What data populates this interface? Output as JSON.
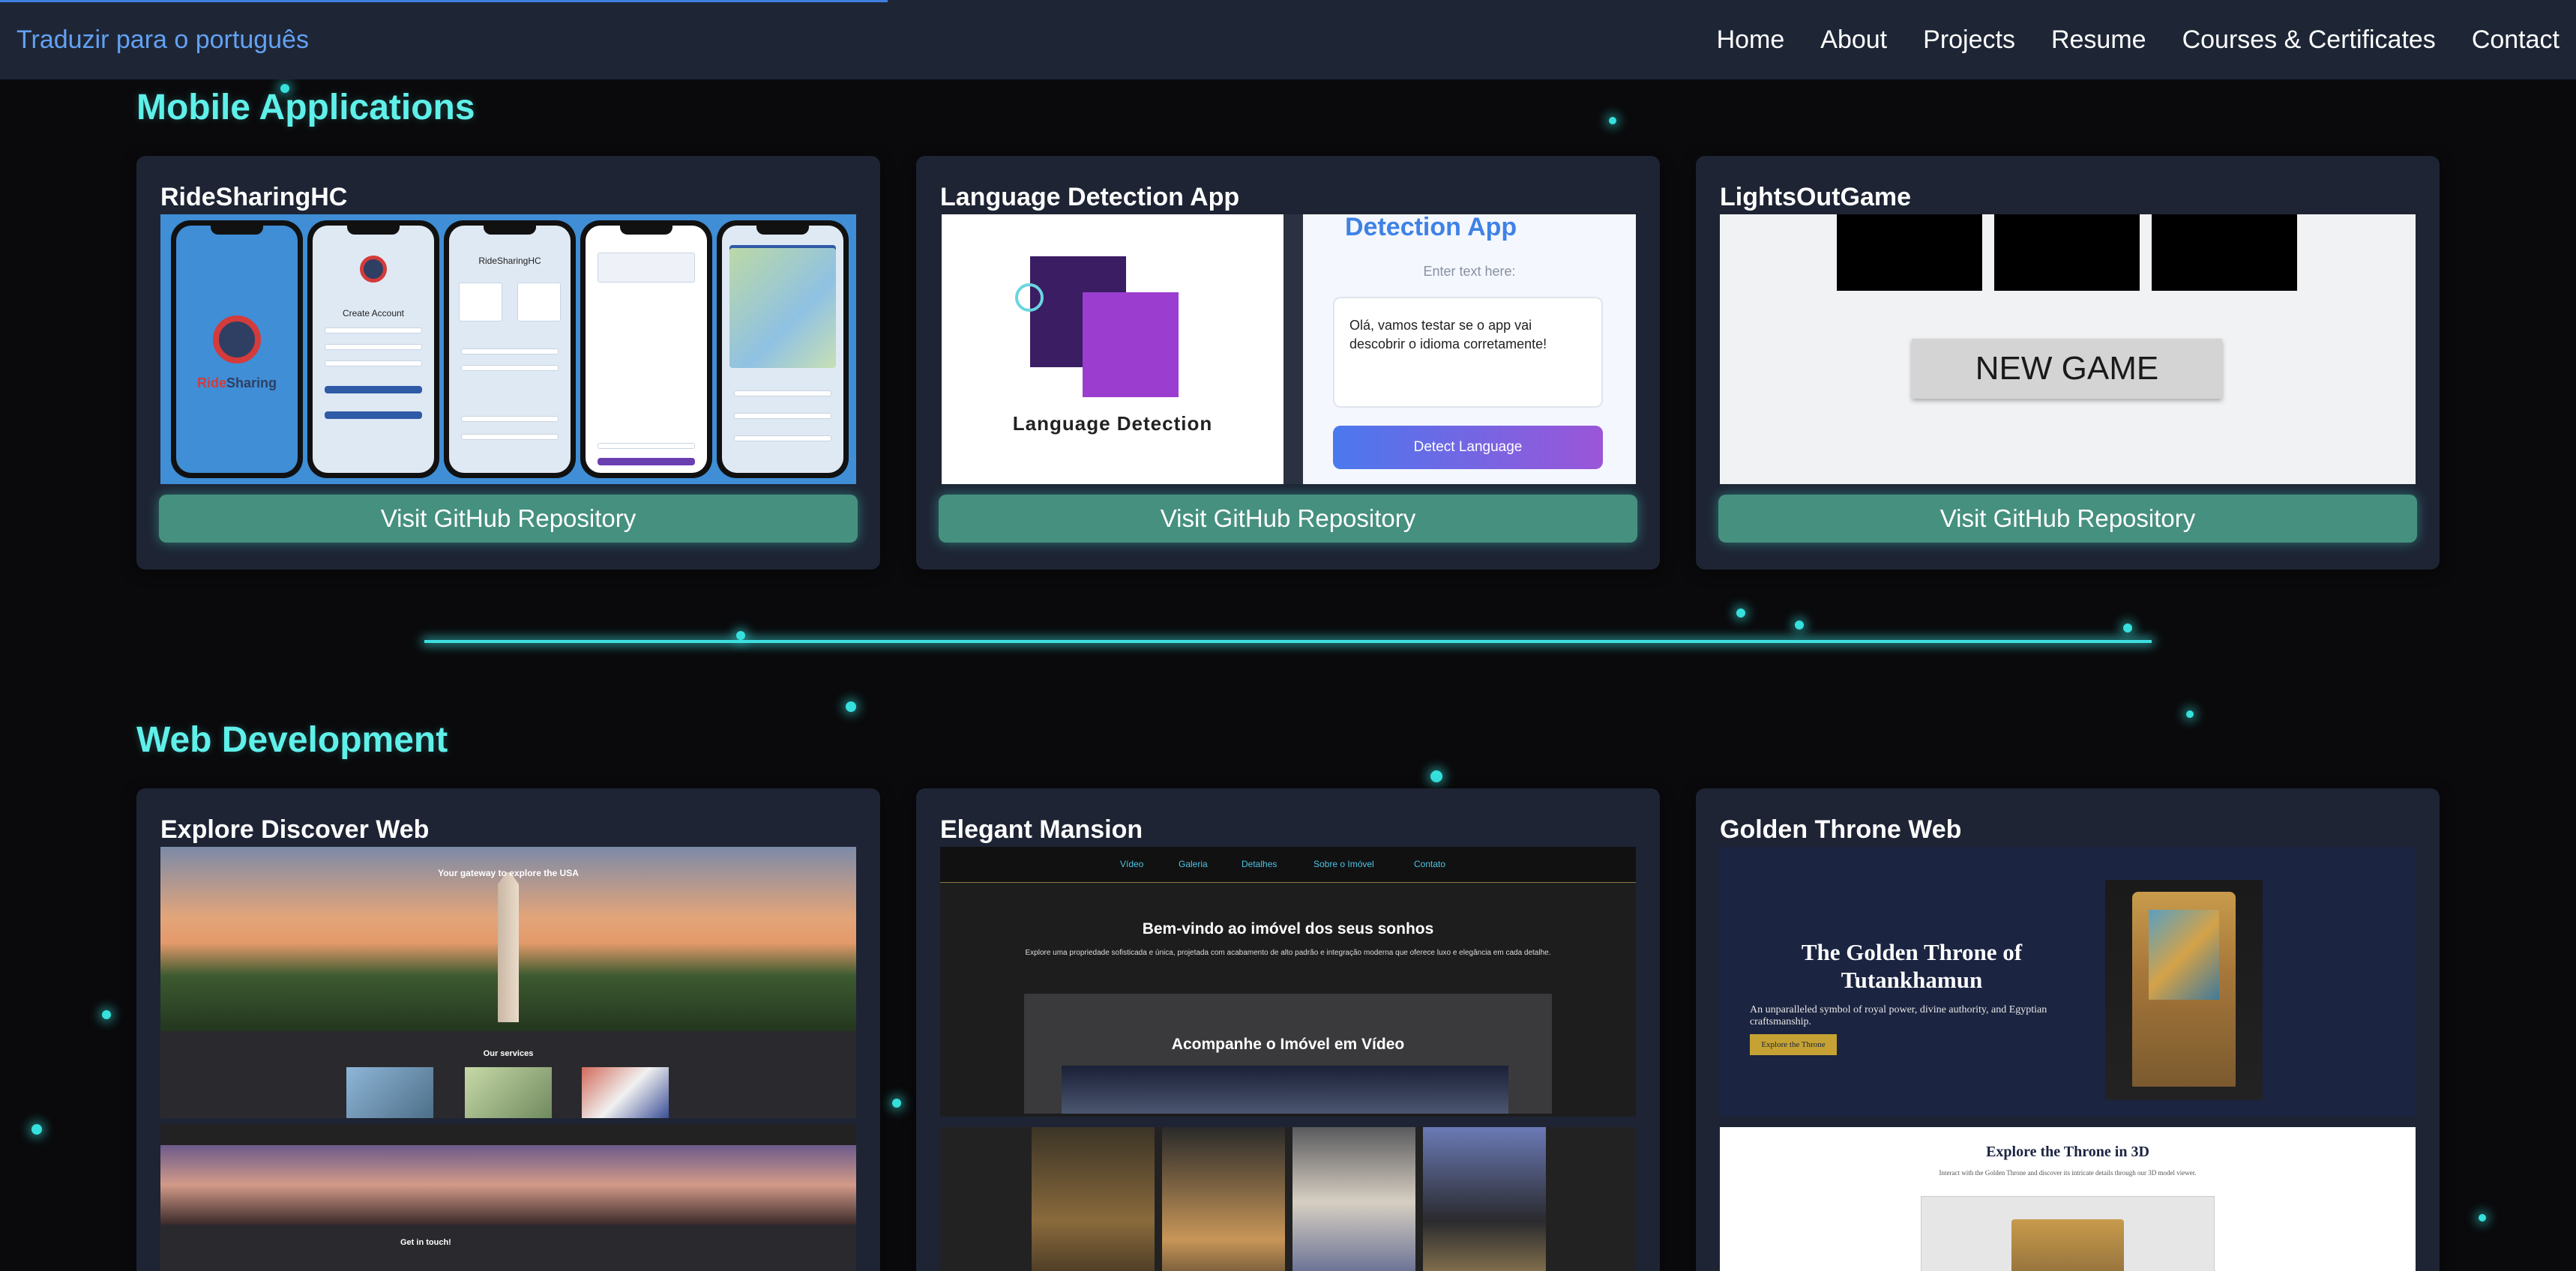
{
  "nav": {
    "translate": "Traduzir para o português",
    "links": [
      "Home",
      "About",
      "Projects",
      "Resume",
      "Courses & Certificates",
      "Contact"
    ]
  },
  "sections": [
    {
      "title": "Mobile Applications",
      "cards": [
        {
          "title": "RideSharingHC",
          "button": "Visit GitHub Repository"
        },
        {
          "title": "Language Detection App",
          "button": "Visit GitHub Repository"
        },
        {
          "title": "LightsOutGame",
          "button": "Visit GitHub Repository"
        }
      ]
    },
    {
      "title": "Web Development",
      "cards": [
        {
          "title": "Explore Discover Web"
        },
        {
          "title": "Elegant Mansion"
        },
        {
          "title": "Golden Throne Web"
        }
      ]
    }
  ],
  "ridesharing": {
    "brand": "RideSharing",
    "create_account": "Create Account",
    "app_name": "RideSharingHC"
  },
  "language_app": {
    "logo_text": "Language Detection",
    "app_title": "Detection App",
    "enter_text": "Enter text here:",
    "input_value": "Olá, vamos testar se o app vai descobrir o idioma corretamente!",
    "detect_button": "Detect Language"
  },
  "lightsout": {
    "new_game": "NEW GAME"
  },
  "explore": {
    "hero": "Your gateway to explore the USA",
    "services": "Our services",
    "get_in_touch": "Get in touch!"
  },
  "mansion": {
    "nav": [
      "Vídeo",
      "Galeria",
      "Detalhes",
      "Sobre o Imóvel",
      "Contato"
    ],
    "welcome": "Bem-vindo ao imóvel dos seus sonhos",
    "desc": "Explore uma propriedade sofisticada e única, projetada com acabamento de alto padrão e integração moderna que oferece luxo e elegância em cada detalhe.",
    "video_title": "Acompanhe o Imóvel em Vídeo"
  },
  "throne": {
    "title": "The Golden Throne of Tutankhamun",
    "desc": "An unparalleled symbol of royal power, divine authority, and Egyptian craftsmanship.",
    "button": "Explore the Throne",
    "explore_3d": "Explore the Throne in 3D",
    "explore_3d_desc": "Interact with the Golden Throne and discover its intricate details through our 3D model viewer."
  },
  "colors": {
    "accent": "#5ff0ea",
    "nav_bg": "#1e2636",
    "card_bg": "#1e2434",
    "button": "#46907f",
    "link": "#63a1f2"
  }
}
